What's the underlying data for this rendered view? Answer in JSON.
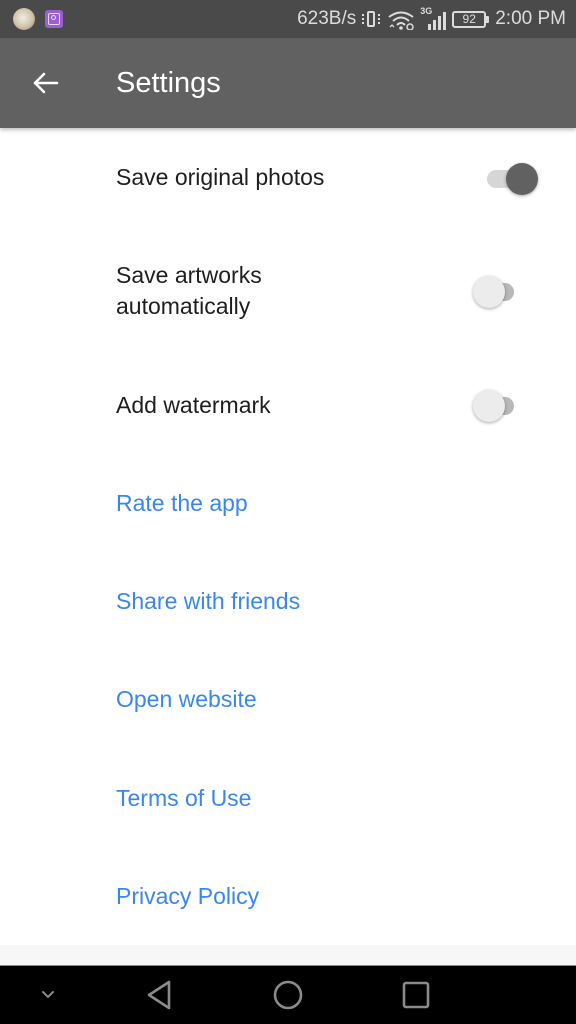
{
  "status_bar": {
    "net_speed": "623B/s",
    "network_type": "3G",
    "battery_level": "92",
    "time": "2:00 PM",
    "notification_icons": [
      "avatar-notification-icon",
      "gallery-notification-icon"
    ],
    "system_icons": [
      "vibrate-icon",
      "wifi-icon",
      "signal-icon",
      "battery-icon"
    ]
  },
  "toolbar": {
    "back_icon": "arrow-left",
    "title": "Settings",
    "background_color": "#616161"
  },
  "settings": {
    "toggles": [
      {
        "label": "Save original photos",
        "on": true
      },
      {
        "label": "Save artworks\nautomatically",
        "on": false
      },
      {
        "label": "Add watermark",
        "on": false
      }
    ],
    "links": [
      {
        "label": "Rate the app"
      },
      {
        "label": "Share with friends"
      },
      {
        "label": "Open website"
      },
      {
        "label": "Terms of Use"
      },
      {
        "label": "Privacy Policy"
      }
    ],
    "link_color": "#3a86ee"
  },
  "nav_bar": {
    "buttons": [
      "hide-nav-chevron",
      "back-triangle",
      "home-circle",
      "recents-square"
    ]
  }
}
